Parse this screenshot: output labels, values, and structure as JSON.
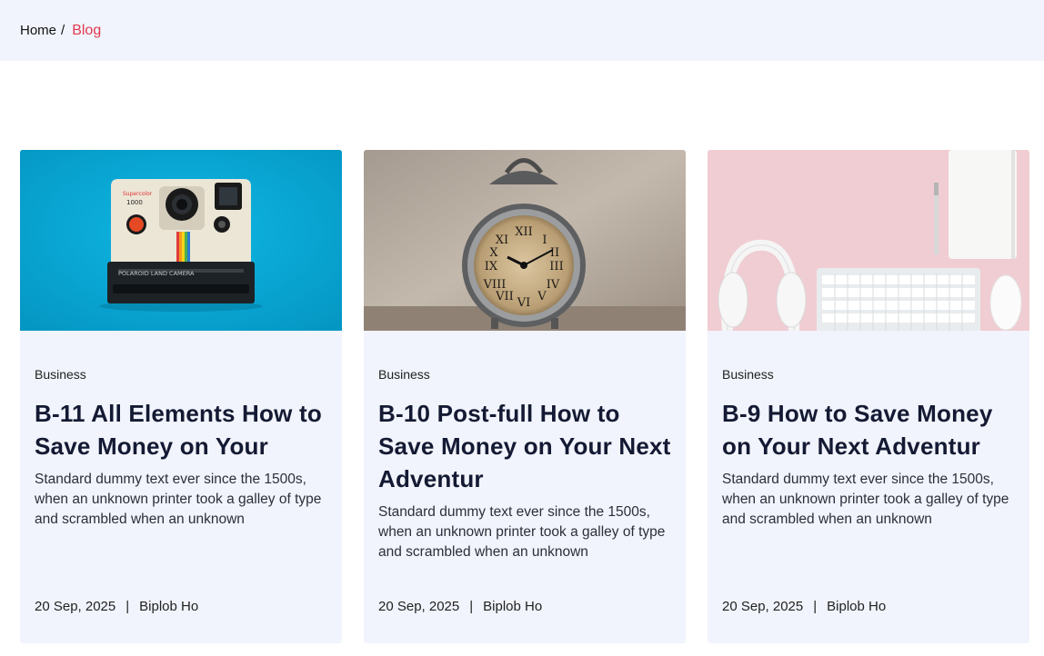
{
  "breadcrumb": {
    "home": "Home",
    "separator": "/",
    "current": "Blog"
  },
  "colors": {
    "accent": "#e0394f",
    "card_bg": "#f1f4fc",
    "title": "#141a33"
  },
  "posts": [
    {
      "image": "polaroid-camera-photo",
      "category": "Business",
      "title": "B-11 All Elements How to Save Money on Your",
      "excerpt": "Standard dummy text ever since the 1500s, when an unknown printer took a galley of type and scrambled when an unknown",
      "date": "20 Sep, 2025",
      "separator": "|",
      "author": "Biplob Ho"
    },
    {
      "image": "alarm-clock-photo",
      "category": "Business",
      "title": "B-10 Post-full How to Save Money on Your Next Adventur",
      "excerpt": "Standard dummy text ever since the 1500s, when an unknown printer took a galley of type and scrambled when an unknown",
      "date": "20 Sep, 2025",
      "separator": "|",
      "author": "Biplob Ho"
    },
    {
      "image": "headphones-keyboard-photo",
      "category": "Business",
      "title": "B-9 How to Save Money on Your Next Adventur",
      "excerpt": "Standard dummy text ever since the 1500s, when an unknown printer took a galley of type and scrambled when an unknown",
      "date": "20 Sep, 2025",
      "separator": "|",
      "author": "Biplob Ho"
    }
  ]
}
